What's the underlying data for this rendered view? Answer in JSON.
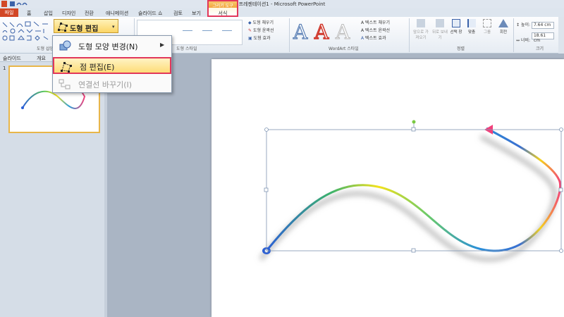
{
  "window": {
    "title": "프레젠테이션1 - Microsoft PowerPoint"
  },
  "context_tab": {
    "group": "그리기 도구",
    "tab": "서식"
  },
  "tabs": [
    {
      "label": "홈"
    },
    {
      "label": "삽입"
    },
    {
      "label": "디자인"
    },
    {
      "label": "전환"
    },
    {
      "label": "애니메이션"
    },
    {
      "label": "슬라이드 쇼"
    },
    {
      "label": "검토"
    },
    {
      "label": "보기"
    }
  ],
  "file_tab": "파일",
  "ribbon": {
    "edit_shape": "도형 편집",
    "insert_shapes_label": "도형 삽입",
    "shape_styles_label": "도형 스타일",
    "shape_fill": "도형 채우기",
    "shape_outline": "도형 윤곽선",
    "shape_effects": "도형 효과",
    "text_fill": "텍스트 채우기",
    "text_outline": "텍스트 윤곽선",
    "text_effects": "텍스트 효과",
    "wordart_label": "WordArt 스타일",
    "bring_forward": "앞으로 가져오기",
    "send_backward": "뒤로 보내기",
    "selection_pane": "선택 창",
    "align": "맞춤",
    "group": "그룹",
    "rotate": "회전",
    "arrange_label": "정렬",
    "height_label": "높이:",
    "height_value": "7.64 cm",
    "width_label": "너비:",
    "width_value": "18.61 cm",
    "size_label": "크기"
  },
  "menu": {
    "change_shape": "도형 모양 변경(N)",
    "edit_points": "점 편집(E)",
    "reroute": "연결선 바꾸기(I)"
  },
  "panel": {
    "tab_slides": "슬라이드",
    "tab_outline": "개요",
    "slide_number": "1"
  },
  "colors": {
    "accent": "#e2375a",
    "file_tab": "#d24726",
    "curve_start": "#2b5fd6",
    "curve_end": "#f2407a"
  }
}
